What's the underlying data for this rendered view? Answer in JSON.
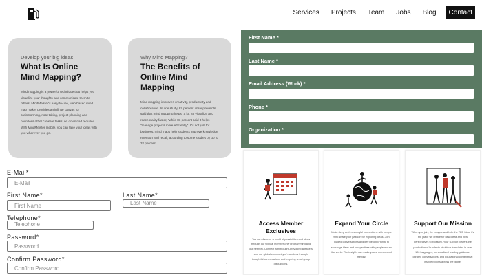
{
  "nav": {
    "items": [
      {
        "label": "Services"
      },
      {
        "label": "Projects"
      },
      {
        "label": "Team"
      },
      {
        "label": "Jobs"
      },
      {
        "label": "Blog"
      }
    ],
    "contact_label": "Contact"
  },
  "cards": [
    {
      "eyebrow": "Develop your big ideas",
      "title": "What Is Online Mind Mapping?",
      "body": "Mind mapping is a powerful technique that helps you visualize your thoughts and communicate them to others. MindMeister's easy-to-use, web-based mind map maker provides an infinite canvas for brainstorming, note taking, project planning and countless other creative tasks, no download required. With MindMeister mobile, you can take your ideas with you wherever you go."
    },
    {
      "eyebrow": "Why Mind Mapping?",
      "title": "The Benefits of Online Mind Mapping",
      "body": "Mind mapping improves creativity, productivity and collaboration. In one study, 87 percent of respondents said that mind mapping helps \"a lot\" to visualize and reach clarity faster, \"while 81 percent said it helps \"manage projects more efficiently\". It's not just for business: mind maps help students improve knowledge retention and recall, according to some studies by up to 32 percent."
    }
  ],
  "form_left": {
    "email_label": "E-Mail*",
    "email_placeholder": "E-Mail",
    "first_name_label": "First Name*",
    "first_name_placeholder": "First Name",
    "last_name_label": "Last Name*",
    "last_name_placeholder": "Last Name",
    "telephone_label": "Telephone*",
    "telephone_placeholder": "Telephone",
    "password_label": "Password*",
    "password_placeholder": "Password",
    "confirm_password_label": "Confirm Password*",
    "confirm_password_placeholder": "Confirm Password"
  },
  "green_form": {
    "background": "#5a7a63",
    "first_name_label": "First Name *",
    "last_name_label": "Last Name *",
    "email_label": "Email Address (Work) *",
    "phone_label": "Phone *",
    "organization_label": "Organization *"
  },
  "features": [
    {
      "icon": "calendar-icon",
      "title": "Access Member Exclusives",
      "body": "You can discover a world of possibilities and ideas through our special member-only programming and our network. Connect with thought-provoking speakers and our global community of members through thoughtful conversations and inspiring small group discussions."
    },
    {
      "icon": "globe-people-icon",
      "title": "Expand Your Circle",
      "body": "Make deep and meaningful connections with people who share your passion for exploring ideas. Join guided conversations and get the opportunity to exchange ideas and perspectives with people around the world. The insights can make you're unexpected friends!"
    },
    {
      "icon": "people-group-icon",
      "title": "Support Our Mission",
      "body": "When you join, the League and help the TED Idea, it's the place we create for new ideas and new perspectives to blossom. Your support powers the production of hundreds of videos translated in over 100 languages, personalized reading guidance, curated conversations, and educational content that inspire billions across the globe."
    }
  ]
}
